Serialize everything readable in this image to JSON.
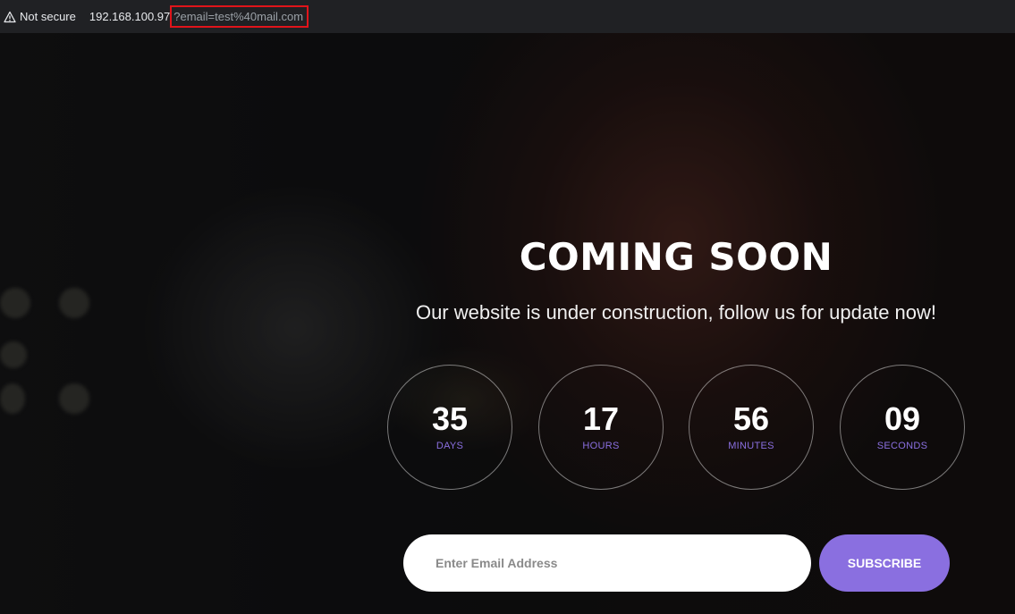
{
  "browser": {
    "security_label": "Not secure",
    "url_host": "192.168.100.97",
    "url_query": "?email=test%40mail.com",
    "warning_icon": "warning-triangle-icon"
  },
  "page": {
    "title": "COMING SOON",
    "subtitle": "Our website is under construction, follow us for update now!",
    "countdown": [
      {
        "value": "35",
        "label": "DAYS"
      },
      {
        "value": "17",
        "label": "HOURS"
      },
      {
        "value": "56",
        "label": "MINUTES"
      },
      {
        "value": "09",
        "label": "SECONDS"
      }
    ],
    "form": {
      "email_placeholder": "Enter Email Address",
      "email_value": "",
      "subscribe_label": "SUBSCRIBE"
    },
    "colors": {
      "accent": "#8a6fe0",
      "highlight_box": "#e0141a"
    }
  }
}
